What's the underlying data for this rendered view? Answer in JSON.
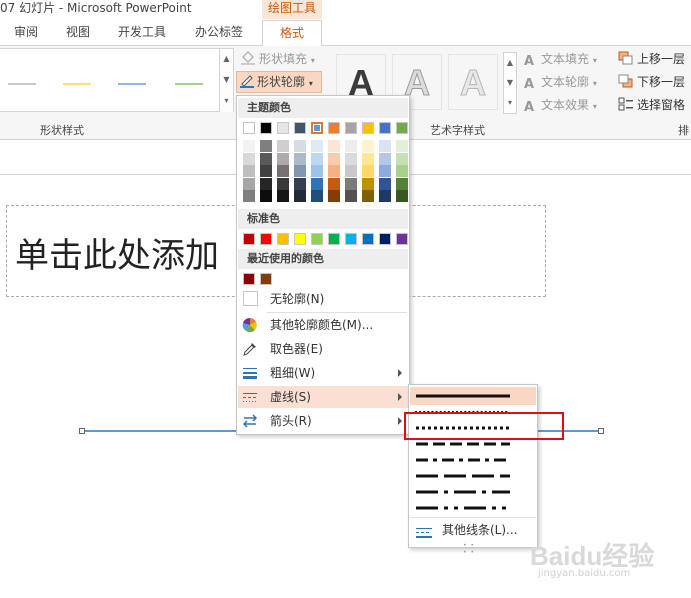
{
  "window": {
    "title": "07 幻灯片 - Microsoft PowerPoint",
    "context_group_label": "绘图工具"
  },
  "tabs": [
    {
      "label": "审阅"
    },
    {
      "label": "视图"
    },
    {
      "label": "开发工具"
    },
    {
      "label": "办公标签"
    },
    {
      "label": "格式",
      "active": true
    }
  ],
  "ribbon": {
    "shape_styles": {
      "group_label": "形状样式",
      "line_colors": [
        "#c9c9c9",
        "#ffe26b",
        "#8fb4e3",
        "#a9d18e"
      ],
      "shape_fill_label": "形状填充",
      "shape_outline_label": "形状轮廓"
    },
    "wordart": {
      "group_label": "艺术字样式",
      "sample_letter": "A",
      "text_fill_label": "文本填充",
      "text_outline_label": "文本轮廓",
      "text_effects_label": "文本效果"
    },
    "arrange": {
      "group_label": "排",
      "bring_forward_label": "上移一层",
      "send_backward_label": "下移一层",
      "selection_pane_label": "选择窗格"
    }
  },
  "slide": {
    "title_placeholder": "单击此处添加"
  },
  "outline_menu": {
    "theme_colors_header": "主题颜色",
    "theme_colors": [
      "#ffffff",
      "#000000",
      "#e7e6e6",
      "#44546a",
      "#5b9bd5",
      "#ed7d31",
      "#a5a5a5",
      "#ffc000",
      "#4472c4",
      "#70ad47"
    ],
    "theme_shades": [
      [
        "#f2f2f2",
        "#d9d9d9",
        "#bfbfbf",
        "#a6a6a6",
        "#7f7f7f"
      ],
      [
        "#7f7f7f",
        "#595959",
        "#404040",
        "#262626",
        "#0d0d0d"
      ],
      [
        "#d0cece",
        "#aeaaaa",
        "#767171",
        "#3a3838",
        "#171616"
      ],
      [
        "#d6dce4",
        "#adb9ca",
        "#8497b0",
        "#333f4f",
        "#222a35"
      ],
      [
        "#ddebf7",
        "#bdd7ee",
        "#9dc3e6",
        "#2e75b6",
        "#1f4e79"
      ],
      [
        "#fbe5d6",
        "#f8cbad",
        "#f4b183",
        "#c55a11",
        "#843c0c"
      ],
      [
        "#ededed",
        "#dbdbdb",
        "#c9c9c9",
        "#7b7b7b",
        "#525252"
      ],
      [
        "#fff2cc",
        "#ffe699",
        "#ffd966",
        "#bf9000",
        "#7f6000"
      ],
      [
        "#dae3f3",
        "#b4c7e7",
        "#8faadc",
        "#2f5597",
        "#203864"
      ],
      [
        "#e2f0d9",
        "#c5e0b4",
        "#a9d18e",
        "#548235",
        "#385723"
      ]
    ],
    "standard_colors_header": "标准色",
    "standard_colors": [
      "#c00000",
      "#ff0000",
      "#ffc000",
      "#ffff00",
      "#92d050",
      "#00b050",
      "#00b0f0",
      "#0070c0",
      "#002060",
      "#7030a0"
    ],
    "recent_colors_header": "最近使用的颜色",
    "recent_colors": [
      "#8b0000",
      "#843c0c"
    ],
    "items": {
      "no_outline": "无轮廓(N)",
      "more_colors": "其他轮廓颜色(M)...",
      "eyedropper": "取色器(E)",
      "weight": "粗细(W)",
      "dashes": "虚线(S)",
      "arrows": "箭头(R)"
    }
  },
  "dash_submenu": {
    "styles": [
      "solid",
      "round-dot",
      "square-dot",
      "dash",
      "dash-dot",
      "long-dash",
      "long-dash-dot",
      "long-dash-dot-dot"
    ],
    "selected": "solid",
    "highlighted": "square-dot",
    "more_lines_label": "其他线条(L)..."
  },
  "watermark": {
    "logo": "Baidu经验",
    "url": "jingyan.baidu.com"
  }
}
